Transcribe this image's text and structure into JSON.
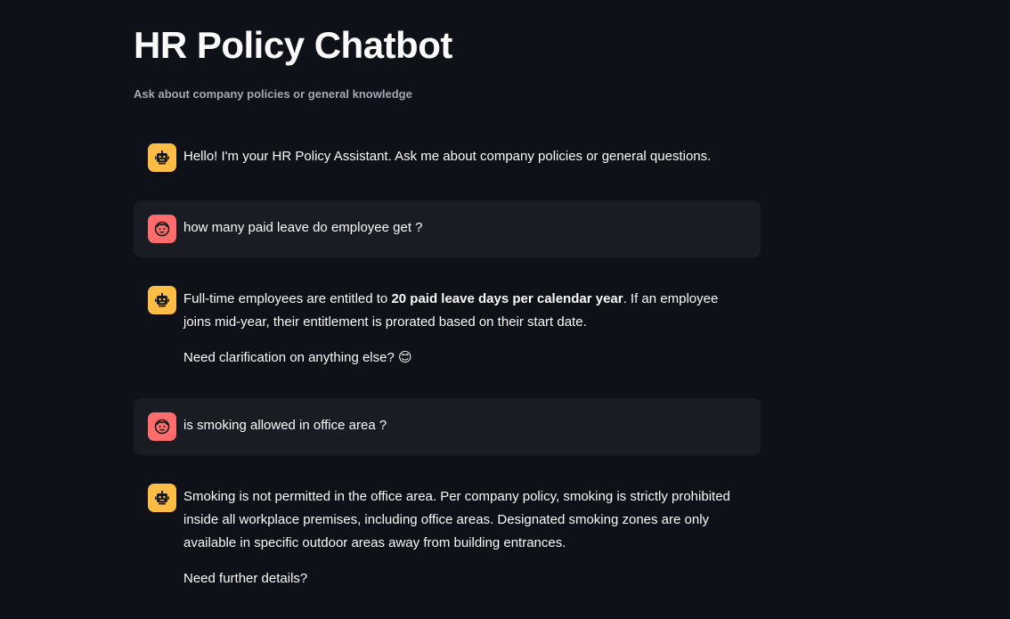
{
  "header": {
    "title": "HR Policy Chatbot",
    "subtitle": "Ask about company policies or general knowledge"
  },
  "messages": [
    {
      "role": "assistant",
      "avatar_icon": "robot-icon",
      "paragraphs": [
        "Hello! I'm your HR Policy Assistant. Ask me about company policies or general questions."
      ]
    },
    {
      "role": "user",
      "avatar_icon": "face-icon",
      "paragraphs": [
        "how many paid leave do employee get ?"
      ]
    },
    {
      "role": "assistant",
      "avatar_icon": "robot-icon",
      "p1_before": "Full-time employees are entitled to ",
      "p1_bold": "20 paid leave days per calendar year",
      "p1_after": ". If an employee joins mid-year, their entitlement is prorated based on their start date.",
      "p2": "Need clarification on anything else? 😊"
    },
    {
      "role": "user",
      "avatar_icon": "face-icon",
      "paragraphs": [
        "is smoking allowed in office area ?"
      ]
    },
    {
      "role": "assistant",
      "avatar_icon": "robot-icon",
      "paragraphs": [
        "Smoking is not permitted in the office area. Per company policy, smoking is strictly prohibited inside all workplace premises, including office areas. Designated smoking zones are only available in specific outdoor areas away from building entrances.",
        "Need further details?"
      ]
    }
  ],
  "colors": {
    "background": "#0e1117",
    "user_bubble": "#1a1c24",
    "assistant_avatar": "#ffbd45",
    "user_avatar": "#ff6c6c"
  }
}
